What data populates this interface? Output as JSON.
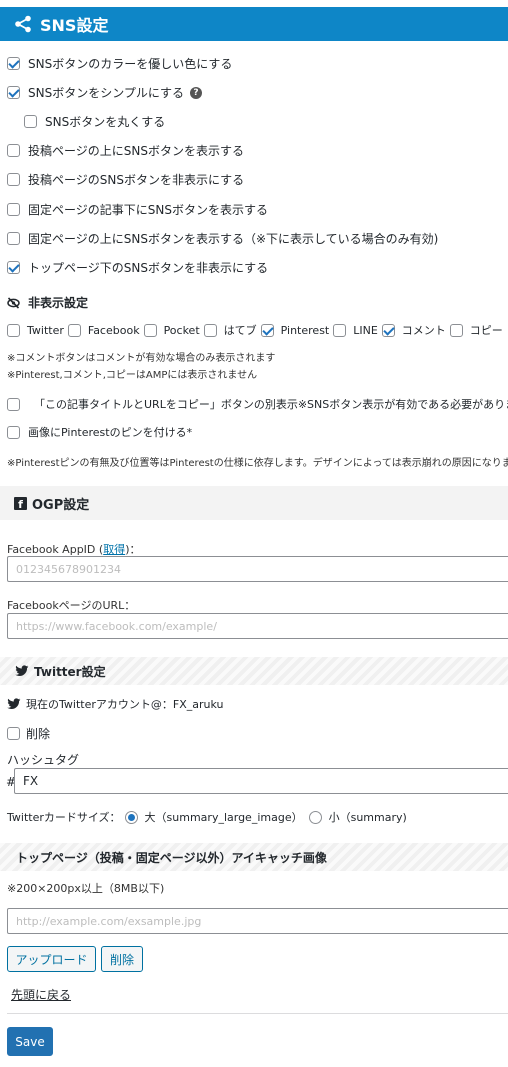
{
  "header": {
    "title": "SNS設定",
    "icon": "share-icon"
  },
  "sns_options": [
    {
      "label": "SNSボタンのカラーを優しい色にする",
      "checked": true
    },
    {
      "label": "SNSボタンをシンプルにする",
      "checked": true,
      "help": "?"
    },
    {
      "label": "SNSボタンを丸くする",
      "checked": false
    },
    {
      "label": "投稿ページの上にSNSボタンを表示する",
      "checked": false
    },
    {
      "label": "投稿ページのSNSボタンを非表示にする",
      "checked": false
    },
    {
      "label": "固定ページの記事下にSNSボタンを表示する",
      "checked": false
    },
    {
      "label": "固定ページの上にSNSボタンを表示する（※下に表示している場合のみ有効)",
      "checked": false
    },
    {
      "label": "トップページ下のSNSボタンを非表示にする",
      "checked": true
    }
  ],
  "hidden_settings": {
    "title": "非表示設定",
    "items": [
      {
        "label": "Twitter",
        "checked": false
      },
      {
        "label": "Facebook",
        "checked": false
      },
      {
        "label": "Pocket",
        "checked": false
      },
      {
        "label": "はてブ",
        "checked": false
      },
      {
        "label": "Pinterest",
        "checked": true
      },
      {
        "label": "LINE",
        "checked": false
      },
      {
        "label": "コメント",
        "checked": true
      },
      {
        "label": "コピー",
        "checked": false
      }
    ],
    "note1": "※コメントボタンはコメントが有効な場合のみ表示されます",
    "note2": "※Pinterest,コメント,コピーはAMPには表示されません"
  },
  "extra_options": [
    {
      "label": "「この記事タイトルとURLをコピー」ボタンの別表示※SNSボタン表示が有効である必要があります",
      "checked": false
    },
    {
      "label": "画像にPinterestのピンを付ける*",
      "checked": false
    }
  ],
  "pinterest_note": "※Pinterestピンの有無及び位置等はPinterestの仕様に依存します。デザインによっては表示崩れの原因になります",
  "ogp": {
    "title": "OGP設定",
    "appid_label": "Facebook AppID (",
    "appid_link": "取得",
    "appid_label_end": ")：",
    "appid_placeholder": "012345678901234",
    "fb_url_label": "FacebookページのURL：",
    "fb_url_placeholder": "https://www.facebook.com/example/"
  },
  "twitter": {
    "title": "Twitter設定",
    "current_account": "現在のTwitterアカウント@：FX_aruku",
    "delete_label": "削除",
    "hashtag_label": "ハッシュタグ",
    "hash_symbol": "#",
    "hashtag_value": "FX",
    "card_size_label": "Twitterカードサイズ：",
    "card_large": "大（summary_large_image）",
    "card_small": "小（summary)",
    "card_selected": "large"
  },
  "top_image": {
    "title": "トップページ（投稿・固定ページ以外）アイキャッチ画像",
    "size_note": "※200×200px以上（8MB以下)",
    "url_placeholder": "http://example.com/exsample.jpg",
    "upload_label": "アップロード",
    "delete_label": "削除"
  },
  "back_to_top": "先頭に戻る",
  "save_label": "Save",
  "colors": {
    "header": "#0e86c7",
    "accent": "#2271b1",
    "check": "#1e73be"
  }
}
